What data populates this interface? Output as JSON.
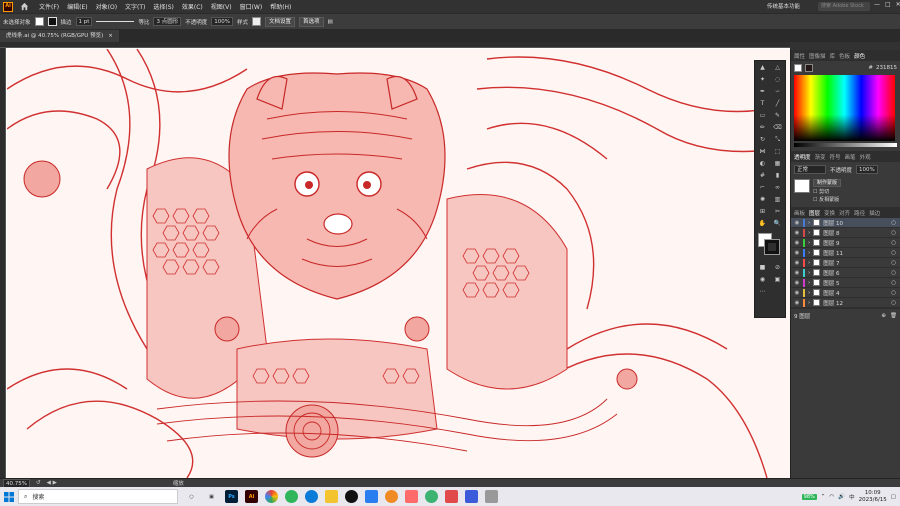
{
  "app": {
    "logo": "Ai",
    "accent": "#ff9a00"
  },
  "menu": [
    "文件(F)",
    "编辑(E)",
    "对象(O)",
    "文字(T)",
    "选择(S)",
    "效果(C)",
    "视图(V)",
    "窗口(W)",
    "帮助(H)"
  ],
  "workspace": "传统基本功能",
  "search_placeholder": "搜索 Adobe Stock",
  "control_bar": {
    "selection": "未选择对象",
    "stroke_label": "描边",
    "stroke_weight": "1 pt",
    "stroke_style": "等比",
    "brush": "3 点圆形",
    "opacity_label": "不透明度",
    "opacity_value": "100%",
    "style_label": "样式",
    "doc_setup": "文档设置",
    "preferences": "首选项"
  },
  "document_tab": {
    "title": "虎线条.ai @ 40.75% (RGB/GPU 预览)",
    "close": "×"
  },
  "panels": {
    "top_tabs": [
      "属性",
      "图像描",
      "库",
      "色板",
      "颜色"
    ],
    "color_hex": "231815",
    "middle_tabs": [
      "透明度",
      "渐变",
      "符号",
      "画笔",
      "外观"
    ],
    "blend_mode": "正常",
    "opacity_label": "不透明度",
    "opacity_value": "100%",
    "create_mask": "制作蒙版",
    "clip": "剪切",
    "invert_mask": "反相蒙版",
    "layer_tabs": [
      "画板",
      "图层",
      "变换",
      "对齐",
      "路径",
      "描边"
    ],
    "layers": [
      {
        "name": "图层 10",
        "color": "#4a7bd4",
        "selected": true
      },
      {
        "name": "图层 8",
        "color": "#d44a4a",
        "selected": false
      },
      {
        "name": "图层 9",
        "color": "#3ccf3c",
        "selected": false
      },
      {
        "name": "图层 11",
        "color": "#3c7cff",
        "selected": false
      },
      {
        "name": "图层 7",
        "color": "#ff4a4a",
        "selected": false
      },
      {
        "name": "图层 6",
        "color": "#3ccfcf",
        "selected": false
      },
      {
        "name": "图层 5",
        "color": "#cf3ccf",
        "selected": false
      },
      {
        "name": "图层 4",
        "color": "#e0c03c",
        "selected": false
      },
      {
        "name": "图层 12",
        "color": "#ff8c3c",
        "selected": false
      }
    ],
    "layer_count": "9 图层"
  },
  "status": {
    "zoom": "40.75%",
    "tool": "缩放"
  },
  "taskbar": {
    "search": "搜索",
    "apps": [
      {
        "name": "Ps",
        "bg": "#001e36",
        "fg": "#31a8ff"
      },
      {
        "name": "Ai",
        "bg": "#330000",
        "fg": "#ff9a00"
      }
    ],
    "battery": "98%",
    "time": "10:09",
    "date": "2023/6/15",
    "ime": "中"
  }
}
